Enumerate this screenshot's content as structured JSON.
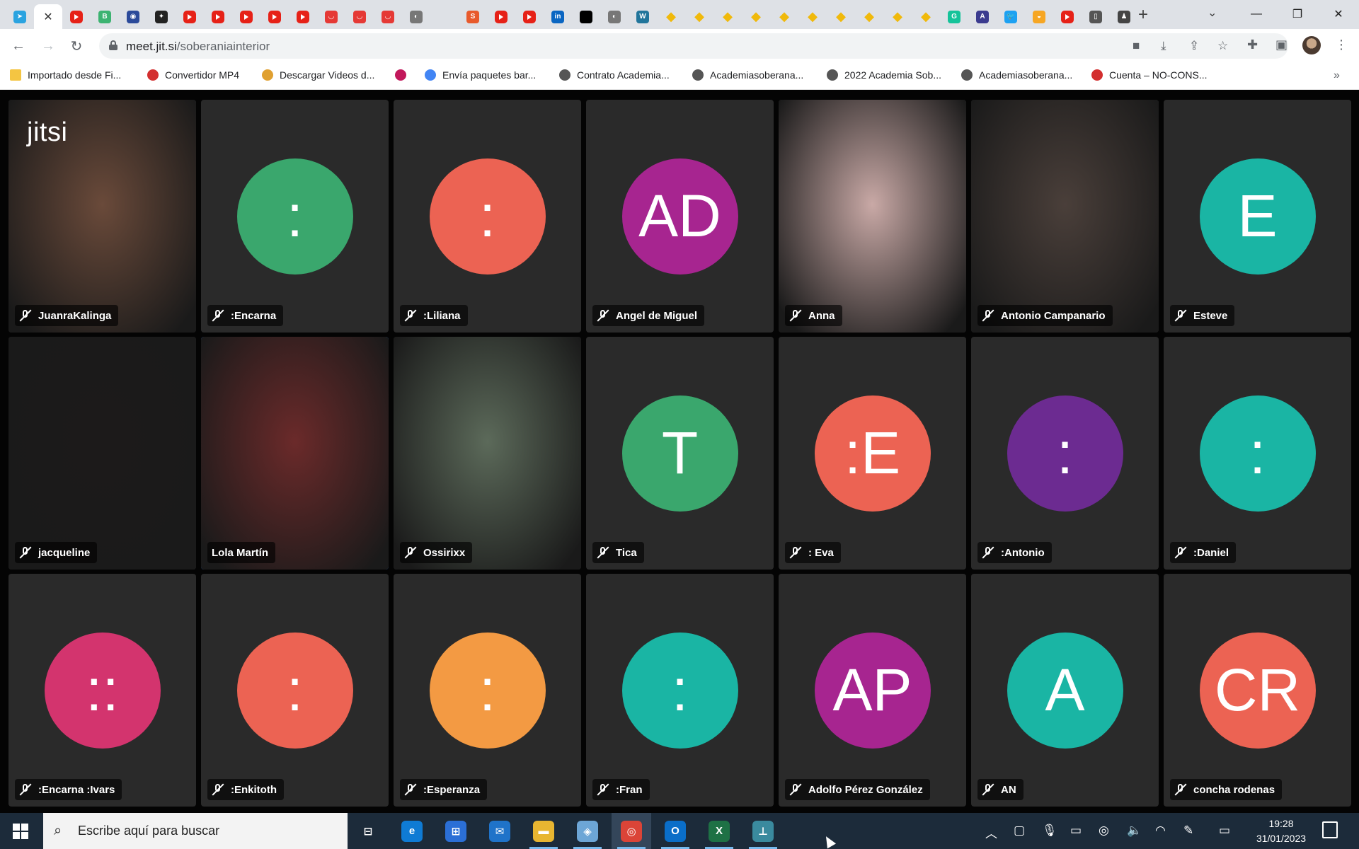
{
  "browser": {
    "tabs": [
      {
        "icon": "telegram-icon",
        "color": "#2aa3e0",
        "glyph": "➤"
      },
      {
        "icon": "close-icon",
        "active": true
      },
      {
        "icon": "youtube-icon",
        "color": "#e62117"
      },
      {
        "icon": "bitcoin-icon",
        "color": "#3cb371",
        "glyph": "B"
      },
      {
        "icon": "globe-icon",
        "color": "#2b4a9a",
        "glyph": "◉"
      },
      {
        "icon": "compass-icon",
        "color": "#222",
        "glyph": "✦"
      },
      {
        "icon": "youtube-icon",
        "color": "#e62117"
      },
      {
        "icon": "youtube-icon",
        "color": "#e62117"
      },
      {
        "icon": "youtube-icon",
        "color": "#e62117"
      },
      {
        "icon": "youtube-icon",
        "color": "#e62117"
      },
      {
        "icon": "youtube-icon",
        "color": "#e62117"
      },
      {
        "icon": "bag-icon",
        "color": "#e53935",
        "glyph": "◡"
      },
      {
        "icon": "bag-icon",
        "color": "#e53935",
        "glyph": "◡"
      },
      {
        "icon": "bag-icon",
        "color": "#e53935",
        "glyph": "◡"
      },
      {
        "icon": "globe-icon",
        "color": "#777",
        "glyph": "◐"
      },
      {
        "icon": "blank-icon",
        "color": "transparent",
        "glyph": ""
      },
      {
        "icon": "scribd-icon",
        "color": "#e85a2c",
        "glyph": "S"
      },
      {
        "icon": "youtube-icon",
        "color": "#e62117"
      },
      {
        "icon": "youtube-icon",
        "color": "#e62117"
      },
      {
        "icon": "linkedin-icon",
        "color": "#0a66c2",
        "glyph": "in"
      },
      {
        "icon": "square-icon",
        "color": "#000",
        "glyph": ""
      },
      {
        "icon": "globe-icon",
        "color": "#777",
        "glyph": "◐"
      },
      {
        "icon": "wordpress-icon",
        "color": "#21759b",
        "glyph": "W"
      },
      {
        "icon": "binance-icon",
        "color": "#f0b90b",
        "glyph": "◆"
      },
      {
        "icon": "binance-icon",
        "color": "#f0b90b",
        "glyph": "◆"
      },
      {
        "icon": "binance-icon",
        "color": "#f0b90b",
        "glyph": "◆"
      },
      {
        "icon": "binance-icon",
        "color": "#f0b90b",
        "glyph": "◆"
      },
      {
        "icon": "binance-icon",
        "color": "#f0b90b",
        "glyph": "◆"
      },
      {
        "icon": "binance-icon",
        "color": "#f0b90b",
        "glyph": "◆"
      },
      {
        "icon": "binance-icon",
        "color": "#f0b90b",
        "glyph": "◆"
      },
      {
        "icon": "binance-icon",
        "color": "#f0b90b",
        "glyph": "◆"
      },
      {
        "icon": "binance-icon",
        "color": "#f0b90b",
        "glyph": "◆"
      },
      {
        "icon": "binance-icon",
        "color": "#f0b90b",
        "glyph": "◆"
      },
      {
        "icon": "grammarly-icon",
        "color": "#15c39a",
        "glyph": "G"
      },
      {
        "icon": "font-icon",
        "color": "#3b3b8f",
        "glyph": "A"
      },
      {
        "icon": "twitter-icon",
        "color": "#1da1f2",
        "glyph": "🐦"
      },
      {
        "icon": "cloud-icon",
        "color": "#f6a623",
        "glyph": "◒"
      },
      {
        "icon": "youtube-icon",
        "color": "#e62117"
      },
      {
        "icon": "doc-icon",
        "color": "#555",
        "glyph": "▯"
      },
      {
        "icon": "person-icon",
        "color": "#444",
        "glyph": "♟"
      }
    ],
    "url_host": "meet.jit.si",
    "url_path": "/soberaniainterior"
  },
  "bookmarks": [
    {
      "label": "Importado desde Fi...",
      "icon": "folder-icon",
      "color": "#f4c542"
    },
    {
      "label": "Convertidor MP4",
      "icon": "mp4-icon",
      "color": "#d32f2f"
    },
    {
      "label": "Descargar Videos d...",
      "icon": "download-icon",
      "color": "#e0a030"
    },
    {
      "label": "",
      "icon": "star-cluster-icon",
      "color": "#c2185b"
    },
    {
      "label": "Envía paquetes bar...",
      "icon": "google-icon",
      "color": "#4285f4"
    },
    {
      "label": "Contrato Academia...",
      "icon": "feather-icon",
      "color": "#555"
    },
    {
      "label": "Academiasoberana...",
      "icon": "feather-icon",
      "color": "#555"
    },
    {
      "label": "2022 Academia Sob...",
      "icon": "feather-icon",
      "color": "#555"
    },
    {
      "label": "Academiasoberana...",
      "icon": "feather-icon",
      "color": "#555"
    },
    {
      "label": "Cuenta – NO-CONS...",
      "icon": "no-icon",
      "color": "#d32f2f"
    }
  ],
  "meeting": {
    "logo": "jitsi",
    "participants": [
      {
        "name": "JuanraKalinga",
        "type": "video",
        "muted": true,
        "bg": "#6a4a3a"
      },
      {
        "name": ":Encarna",
        "type": "avatar",
        "initials": ":",
        "color": "#3aa76d",
        "muted": true
      },
      {
        "name": ":Liliana",
        "type": "avatar",
        "initials": ":",
        "color": "#ec6353",
        "muted": true
      },
      {
        "name": "Angel de Miguel",
        "type": "avatar",
        "initials": "AD",
        "color": "#a72590",
        "muted": true
      },
      {
        "name": "Anna",
        "type": "video",
        "muted": true,
        "bg": "#c9a9a6"
      },
      {
        "name": "Antonio Campanario",
        "type": "video",
        "muted": true,
        "bg": "#4a3f3a"
      },
      {
        "name": "Esteve",
        "type": "avatar",
        "initials": "E",
        "color": "#1ab5a4",
        "muted": true
      },
      {
        "name": "jacqueline",
        "type": "video",
        "muted": true,
        "bg": "#1c1a1a"
      },
      {
        "name": "Lola Martín",
        "type": "video",
        "muted": false,
        "active": true,
        "bg": "#6b2a2a"
      },
      {
        "name": "Ossirixx",
        "type": "video",
        "muted": true,
        "bg": "#5c6a5a"
      },
      {
        "name": "Tica",
        "type": "avatar",
        "initials": "T",
        "color": "#3aa76d",
        "muted": true
      },
      {
        "name": ": Eva",
        "type": "avatar",
        "initials": ":E",
        "color": "#ec6353",
        "muted": true
      },
      {
        "name": ":Antonio",
        "type": "avatar",
        "initials": ":",
        "color": "#6c2b91",
        "muted": true
      },
      {
        "name": ":Daniel",
        "type": "avatar",
        "initials": ":",
        "color": "#1ab5a4",
        "muted": true
      },
      {
        "name": ":Encarna :Ivars",
        "type": "avatar",
        "initials": "::",
        "color": "#d3346e",
        "muted": true
      },
      {
        "name": ":Enkitoth",
        "type": "avatar",
        "initials": ":",
        "color": "#ec6353",
        "muted": true
      },
      {
        "name": ":Esperanza",
        "type": "avatar",
        "initials": ":",
        "color": "#f39a43",
        "muted": true
      },
      {
        "name": ":Fran",
        "type": "avatar",
        "initials": ":",
        "color": "#1ab5a4",
        "muted": true
      },
      {
        "name": "Adolfo Pérez González",
        "type": "avatar",
        "initials": "AP",
        "color": "#a72590",
        "muted": true
      },
      {
        "name": "AN",
        "type": "avatar",
        "initials": "A",
        "color": "#1ab5a4",
        "muted": true
      },
      {
        "name": "concha rodenas",
        "type": "avatar",
        "initials": "CR",
        "color": "#ec6353",
        "muted": true
      }
    ]
  },
  "taskbar": {
    "search_placeholder": "Escribe aquí para buscar",
    "apps": [
      {
        "icon": "task-view-icon",
        "color": "transparent",
        "glyph": "⊟"
      },
      {
        "icon": "edge-icon",
        "color": "#0f7bd4",
        "glyph": "e"
      },
      {
        "icon": "store-icon",
        "color": "#2b6fd6",
        "glyph": "⊞"
      },
      {
        "icon": "mail-icon",
        "color": "#1f73c9",
        "glyph": "✉"
      },
      {
        "icon": "file-explorer-icon",
        "color": "#e8b631",
        "glyph": "▬"
      },
      {
        "icon": "photos-icon",
        "color": "#6da6d6",
        "glyph": "◈"
      },
      {
        "icon": "chrome-icon",
        "color": "#db4437",
        "glyph": "◎"
      },
      {
        "icon": "outlook-icon",
        "color": "#0a6ec8",
        "glyph": "O"
      },
      {
        "icon": "excel-icon",
        "color": "#1e7145",
        "glyph": "X"
      },
      {
        "icon": "app-icon",
        "color": "#3a8a9e",
        "glyph": "⊥"
      }
    ],
    "time": "19:28",
    "date": "31/01/2023"
  }
}
